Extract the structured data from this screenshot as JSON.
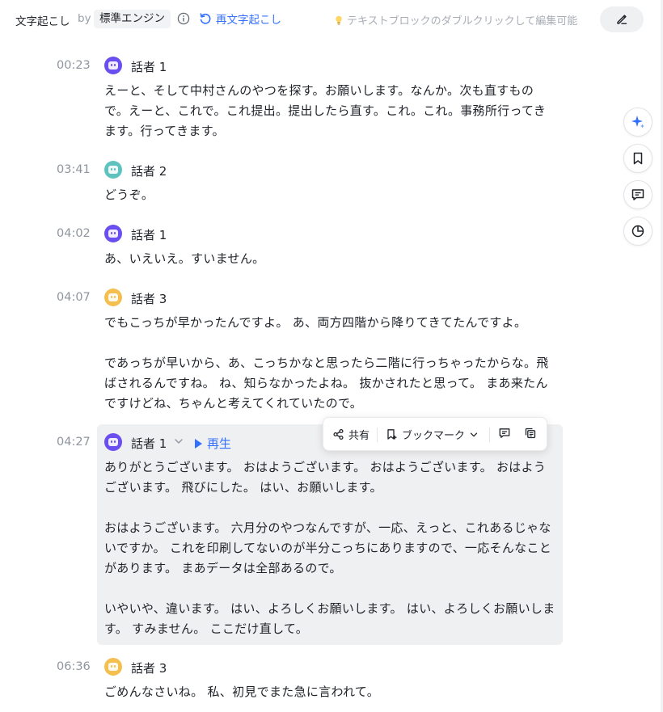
{
  "header": {
    "title": "文字起こし",
    "by": "by",
    "engine": "標準エンジン",
    "redo_label": "再文字起こし",
    "hint": "テキストブロックのダブルクリックして編集可能"
  },
  "colors": {
    "accent": "#3370ff",
    "speaker1": "#6b4ef0",
    "speaker2": "#5ec3bf",
    "speaker3": "#f4bf4f",
    "active_bg": "#eff0f1"
  },
  "toolbar": {
    "share": "共有",
    "bookmark": "ブックマーク"
  },
  "active": {
    "play_label": "再生"
  },
  "segments": [
    {
      "time": "00:23",
      "speaker": "話者 1",
      "paragraphs": [
        "えーと、そして中村さんのやつを探す。お願いします。なんか。次も直すもので。えーと、これで。これ提出。提出したら直す。これ。これ。事務所行ってきます。行ってきます。"
      ]
    },
    {
      "time": "03:41",
      "speaker": "話者 2",
      "paragraphs": [
        "どうぞ。"
      ]
    },
    {
      "time": "04:02",
      "speaker": "話者 1",
      "paragraphs": [
        "あ、いえいえ。すいません。"
      ]
    },
    {
      "time": "04:07",
      "speaker": "話者 3",
      "paragraphs": [
        "でもこっちが早かったんですよ。 あ、両方四階から降りてきてたんですよ。",
        "であっちが早いから、あ、こっちかなと思ったら二階に行っちゃったからな。飛ばされるんですね。 ね、知らなかったよね。 抜かされたと思って。 まあ来たんですけどね、ちゃんと考えてくれていたので。"
      ]
    },
    {
      "time": "04:27",
      "speaker": "話者 1",
      "paragraphs": [
        "ありがとうございます。 おはようございます。 おはようございます。 おはようございます。 飛びにした。 はい、お願いします。",
        "おはようございます。 六月分のやつなんですが、一応、えっと、これあるじゃないですか。 これを印刷してないのが半分こっちにありますので、一応そんなことがあります。 まあデータは全部あるので。",
        "いやいや、違います。 はい、よろしくお願いします。 はい、よろしくお願いします。 すみません。 ここだけ直して。"
      ]
    },
    {
      "time": "06:36",
      "speaker": "話者 3",
      "paragraphs": [
        "ごめんなさいね。 私、初見でまた急に言われて。"
      ]
    }
  ]
}
